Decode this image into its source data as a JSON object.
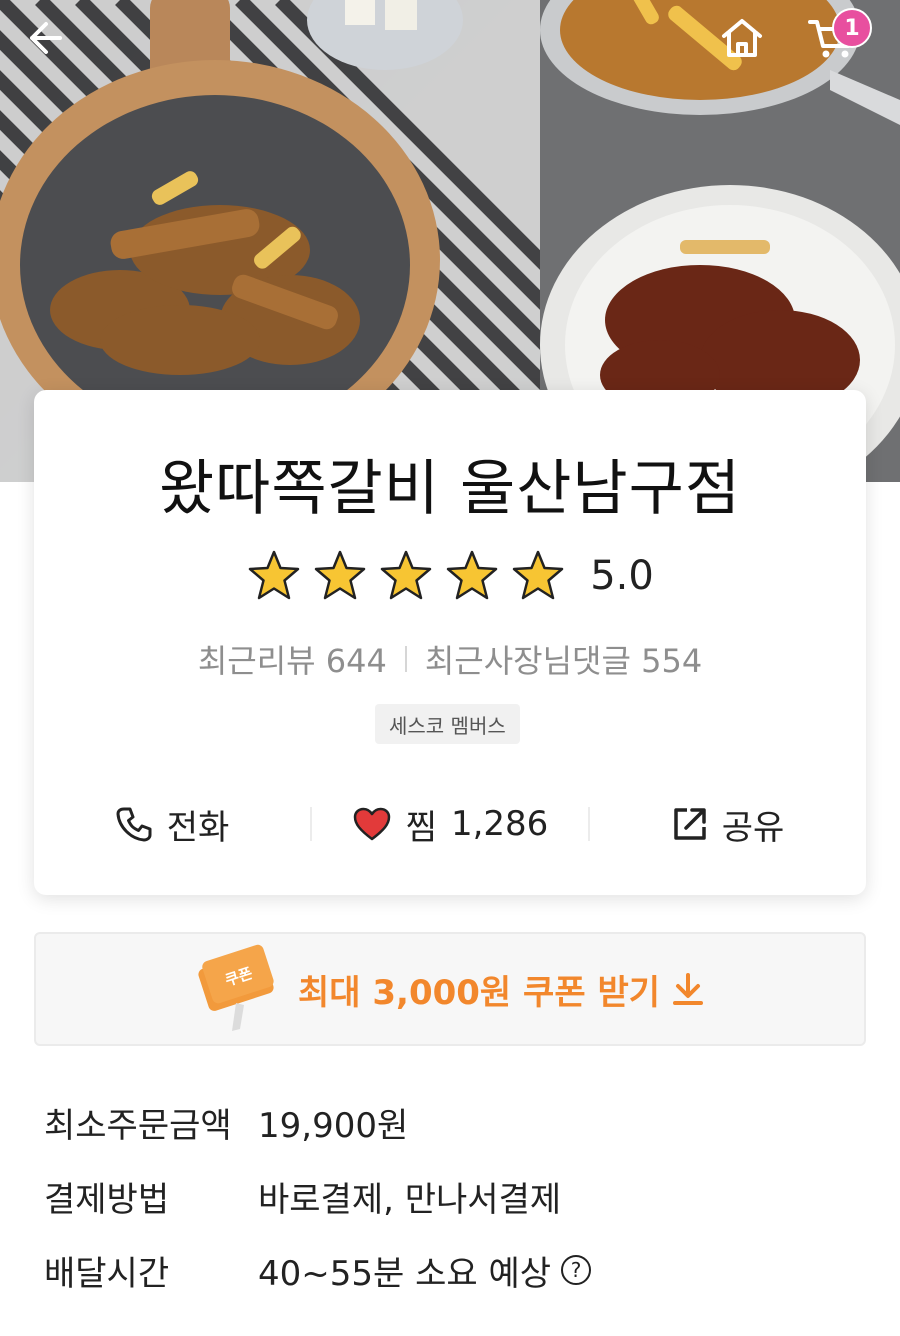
{
  "header": {
    "back_icon": "back-arrow-icon",
    "home_icon": "home-icon",
    "cart_icon": "cart-icon",
    "cart_count": "1",
    "badge_color": "#e84f9f"
  },
  "store": {
    "name": "왔따쪽갈비 울산남구점",
    "rating": {
      "stars": 5,
      "max_stars": 5,
      "score": "5.0",
      "star_color": "#f7c533"
    },
    "reviews": {
      "recent_reviews_label": "최근리뷰",
      "recent_reviews_count": "644",
      "owner_replies_label": "최근사장님댓글",
      "owner_replies_count": "554"
    },
    "member_badge": "세스코 멤버스",
    "actions": {
      "call_label": "전화",
      "favorite_label": "찜",
      "favorite_count": "1,286",
      "share_label": "공유"
    }
  },
  "coupon": {
    "ticket_label": "쿠폰",
    "text": "최대 3,000원 쿠폰 받기",
    "accent_color": "#f2872c"
  },
  "info": {
    "min_order_label": "최소주문금액",
    "min_order_value": "19,900원",
    "payment_label": "결제방법",
    "payment_value": "바로결제, 만나서결제",
    "delivery_label": "배달시간",
    "delivery_value": "40~55분 소요 예상",
    "help_icon": "question-circle-icon"
  }
}
